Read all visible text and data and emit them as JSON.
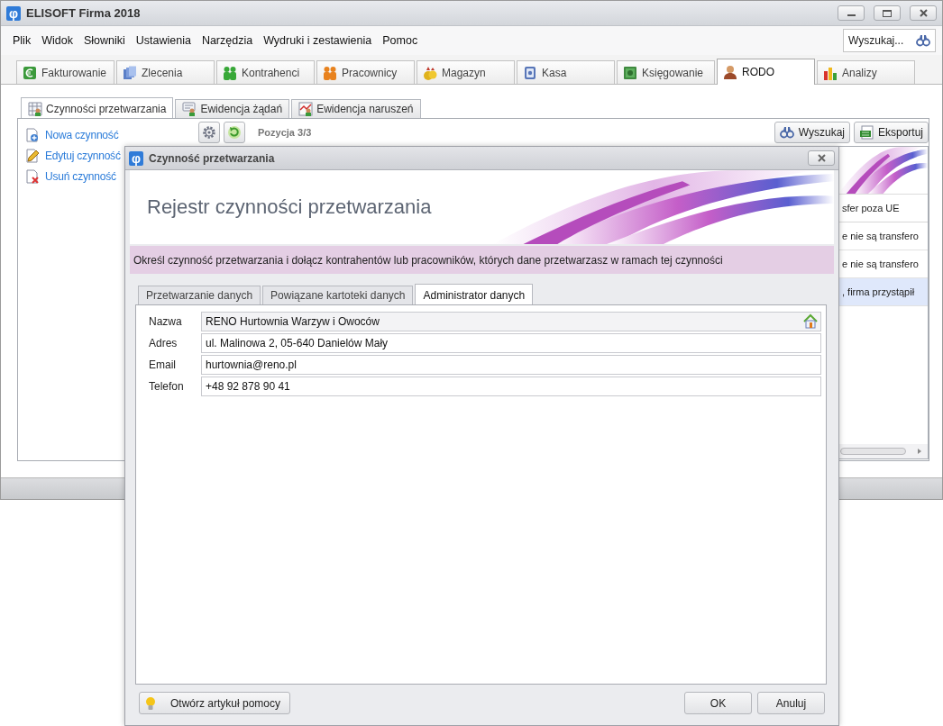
{
  "window": {
    "logo": "φ",
    "title": "ELISOFT Firma 2018"
  },
  "menu": [
    "Plik",
    "Widok",
    "Słowniki",
    "Ustawienia",
    "Narzędzia",
    "Wydruki i zestawienia",
    "Pomoc"
  ],
  "search": {
    "placeholder": "Wyszukaj..."
  },
  "modules": [
    {
      "label": "Fakturowanie",
      "kind": "money",
      "selected": false
    },
    {
      "label": "Zlecenia",
      "kind": "orders",
      "selected": false
    },
    {
      "label": "Kontrahenci",
      "kind": "clients",
      "selected": false
    },
    {
      "label": "Pracownicy",
      "kind": "staff",
      "selected": false
    },
    {
      "label": "Magazyn",
      "kind": "warehouse",
      "selected": false
    },
    {
      "label": "Kasa",
      "kind": "cash",
      "selected": false
    },
    {
      "label": "Księgowanie",
      "kind": "accounting",
      "selected": false
    },
    {
      "label": "RODO",
      "kind": "gdpr",
      "selected": true
    },
    {
      "label": "Analizy",
      "kind": "analytics",
      "selected": false
    }
  ],
  "subtabs": [
    {
      "label": "Czynności przetwarzania",
      "kind": "register",
      "selected": true
    },
    {
      "label": "Ewidencja żądań",
      "kind": "requests",
      "selected": false
    },
    {
      "label": "Ewidencja naruszeń",
      "kind": "breaches",
      "selected": false
    }
  ],
  "actions": [
    {
      "label": "Nowa czynność",
      "kind": "new"
    },
    {
      "label": "Edytuj czynność",
      "kind": "edit"
    },
    {
      "label": "Usuń czynność",
      "kind": "delete"
    }
  ],
  "toolbar": {
    "position": "Pozycja 3/3",
    "buttons": [
      {
        "label": "Wyszukaj",
        "kind": "search"
      },
      {
        "label": "Eksportuj",
        "kind": "export"
      }
    ]
  },
  "grid": {
    "column": "sfer poza UE",
    "rows": [
      {
        "text": "e nie są transfero",
        "selected": false
      },
      {
        "text": "e nie są transfero",
        "selected": false
      },
      {
        "text": ", firma przystąpił",
        "selected": true
      }
    ]
  },
  "dialog": {
    "logo": "φ",
    "title": "Czynność przetwarzania",
    "heading": "Rejestr czynności przetwarzania",
    "instruction": "Określ czynność przetwarzania i dołącz kontrahentów lub pracowników, których dane przetwarzasz w ramach tej czynności",
    "tabs": [
      {
        "label": "Przetwarzanie danych",
        "selected": false
      },
      {
        "label": "Powiązane kartoteki danych",
        "selected": false
      },
      {
        "label": "Administrator danych",
        "selected": true
      }
    ],
    "fields": [
      {
        "label": "Nazwa",
        "value": "RENO Hurtownia Warzyw i Owoców",
        "kind": "lookup"
      },
      {
        "label": "Adres",
        "value": "ul. Malinowa 2, 05-640 Danielów Mały",
        "kind": "text"
      },
      {
        "label": "Email",
        "value": "hurtownia@reno.pl",
        "kind": "text"
      },
      {
        "label": "Telefon",
        "value": "+48 92 878 90 41",
        "kind": "text"
      }
    ],
    "help_button": "Otwórz artykuł pomocy",
    "buttons": [
      "OK",
      "Anuluj"
    ]
  }
}
